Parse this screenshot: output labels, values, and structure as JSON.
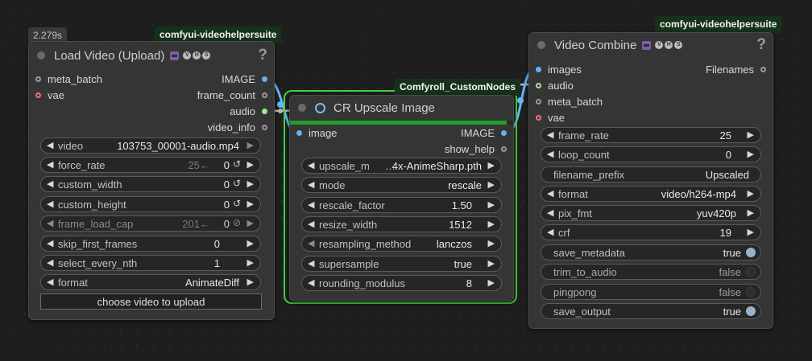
{
  "colors": {
    "canvas": "#1e1e1e",
    "node_bg": "#353535",
    "pack_badge": "#17321b",
    "selected_outline": "#3fd43f",
    "progress": "#1f9e2a",
    "image_slot": "#6ab0f0",
    "audio_slot": "#a6e69c",
    "vae_slot": "#ff6e6e",
    "latent_slot": "#9a9a9a",
    "link_image": "#64b5f6",
    "link_audio": "#b8b8b8"
  },
  "timing": "2.279s",
  "load_video": {
    "pack": "comfyui-videohelpersuite",
    "title": "Load Video (Upload)",
    "help": "?",
    "inputs": [
      {
        "name": "meta_batch"
      },
      {
        "name": "vae"
      }
    ],
    "outputs": [
      {
        "name": "IMAGE"
      },
      {
        "name": "frame_count"
      },
      {
        "name": "audio"
      },
      {
        "name": "video_info"
      }
    ],
    "widgets": [
      {
        "label": "video",
        "value": "103753_00001-audio.mp4"
      },
      {
        "label": "force_rate",
        "ghost": "25←",
        "value": "0"
      },
      {
        "label": "custom_width",
        "value": "0"
      },
      {
        "label": "custom_height",
        "value": "0"
      },
      {
        "label": "frame_load_cap",
        "ghost": "201←",
        "value": "0"
      },
      {
        "label": "skip_first_frames",
        "value": "0"
      },
      {
        "label": "select_every_nth",
        "value": "1"
      },
      {
        "label": "format",
        "value": "AnimateDiff"
      }
    ],
    "upload_button": "choose video to upload"
  },
  "upscale": {
    "pack": "Comfyroll_CustomNodes",
    "title": "CR Upscale Image",
    "progress": 0.97,
    "input": "image",
    "outputs": [
      {
        "name": "IMAGE"
      },
      {
        "name": "show_help"
      }
    ],
    "widgets": [
      {
        "label": "upscale_m",
        "value": "4x-AnimeSharp.pth"
      },
      {
        "label": "mode",
        "value": "rescale"
      },
      {
        "label": "rescale_factor",
        "value": "1.50"
      },
      {
        "label": "resize_width",
        "value": "1512"
      },
      {
        "label": "resampling_method",
        "value": "lanczos"
      },
      {
        "label": "supersample",
        "value": "true"
      },
      {
        "label": "rounding_modulus",
        "value": "8"
      }
    ]
  },
  "video_combine": {
    "pack": "comfyui-videohelpersuite",
    "title": "Video Combine",
    "help": "?",
    "inputs": [
      {
        "name": "images"
      },
      {
        "name": "audio"
      },
      {
        "name": "meta_batch"
      },
      {
        "name": "vae"
      }
    ],
    "output": "Filenames",
    "widgets": [
      {
        "label": "frame_rate",
        "value": "25"
      },
      {
        "label": "loop_count",
        "value": "0"
      },
      {
        "label": "filename_prefix",
        "value": "Upscaled"
      },
      {
        "label": "format",
        "value": "video/h264-mp4"
      },
      {
        "label": "pix_fmt",
        "value": "yuv420p"
      },
      {
        "label": "crf",
        "value": "19"
      },
      {
        "label": "save_metadata",
        "value": "true"
      },
      {
        "label": "trim_to_audio",
        "value": "false"
      },
      {
        "label": "pingpong",
        "value": "false"
      },
      {
        "label": "save_output",
        "value": "true"
      }
    ]
  }
}
